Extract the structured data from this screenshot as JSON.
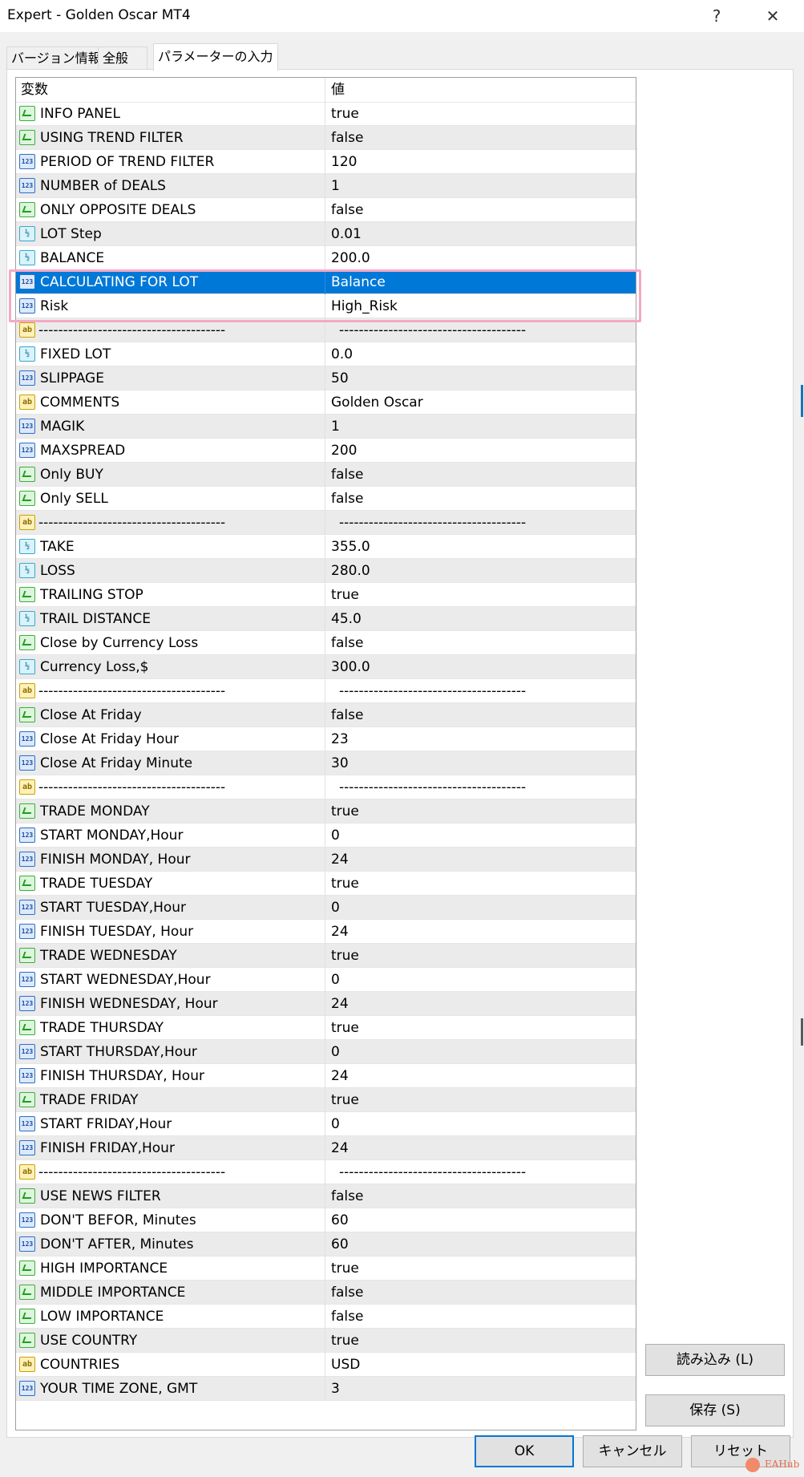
{
  "window": {
    "title": "Expert - Golden Oscar MT4",
    "help_glyph": "?",
    "close_glyph": "✕"
  },
  "tabs": [
    {
      "label": "バージョン情報",
      "active": false
    },
    {
      "label": "全般",
      "active": false
    },
    {
      "label": "パラメーターの入力",
      "active": true
    }
  ],
  "grid": {
    "col_variable": "変数",
    "col_value": "値",
    "rows": [
      {
        "name": "INFO PANEL",
        "value": "true",
        "type": "bool"
      },
      {
        "name": "USING TREND FILTER",
        "value": "false",
        "type": "bool"
      },
      {
        "name": "PERIOD OF TREND FILTER",
        "value": "120",
        "type": "int"
      },
      {
        "name": "NUMBER of DEALS",
        "value": "1",
        "type": "int"
      },
      {
        "name": "ONLY OPPOSITE DEALS",
        "value": "false",
        "type": "bool"
      },
      {
        "name": "LOT Step",
        "value": "0.01",
        "type": "double"
      },
      {
        "name": "BALANCE",
        "value": "200.0",
        "type": "double"
      },
      {
        "name": "CALCULATING FOR LOT",
        "value": "Balance",
        "type": "int",
        "selected": true
      },
      {
        "name": "Risk",
        "value": "High_Risk",
        "type": "int"
      },
      {
        "name": "--------------------------------------",
        "value": "--------------------------------------",
        "type": "string"
      },
      {
        "name": "FIXED LOT",
        "value": "0.0",
        "type": "double"
      },
      {
        "name": "SLIPPAGE",
        "value": "50",
        "type": "int"
      },
      {
        "name": "COMMENTS",
        "value": "Golden Oscar",
        "type": "string"
      },
      {
        "name": "MAGIK",
        "value": "1",
        "type": "int"
      },
      {
        "name": "MAXSPREAD",
        "value": "200",
        "type": "int"
      },
      {
        "name": "Only BUY",
        "value": "false",
        "type": "bool"
      },
      {
        "name": "Only SELL",
        "value": "false",
        "type": "bool"
      },
      {
        "name": "--------------------------------------",
        "value": "--------------------------------------",
        "type": "string"
      },
      {
        "name": "TAKE",
        "value": "355.0",
        "type": "double"
      },
      {
        "name": "LOSS",
        "value": "280.0",
        "type": "double"
      },
      {
        "name": "TRAILING STOP",
        "value": "true",
        "type": "bool"
      },
      {
        "name": "TRAIL DISTANCE",
        "value": "45.0",
        "type": "double"
      },
      {
        "name": "Close by Currency Loss",
        "value": "false",
        "type": "bool"
      },
      {
        "name": "Currency Loss,$",
        "value": "300.0",
        "type": "double"
      },
      {
        "name": "--------------------------------------",
        "value": "--------------------------------------",
        "type": "string"
      },
      {
        "name": "Close At Friday",
        "value": "false",
        "type": "bool"
      },
      {
        "name": "Close At Friday Hour",
        "value": "23",
        "type": "int"
      },
      {
        "name": "Close At Friday Minute",
        "value": "30",
        "type": "int"
      },
      {
        "name": "--------------------------------------",
        "value": "--------------------------------------",
        "type": "string"
      },
      {
        "name": "TRADE MONDAY",
        "value": "true",
        "type": "bool"
      },
      {
        "name": "START MONDAY,Hour",
        "value": "0",
        "type": "int"
      },
      {
        "name": "FINISH MONDAY, Hour",
        "value": "24",
        "type": "int"
      },
      {
        "name": "TRADE TUESDAY",
        "value": "true",
        "type": "bool"
      },
      {
        "name": "START TUESDAY,Hour",
        "value": "0",
        "type": "int"
      },
      {
        "name": "FINISH TUESDAY, Hour",
        "value": "24",
        "type": "int"
      },
      {
        "name": "TRADE WEDNESDAY",
        "value": "true",
        "type": "bool"
      },
      {
        "name": "START WEDNESDAY,Hour",
        "value": "0",
        "type": "int"
      },
      {
        "name": "FINISH WEDNESDAY, Hour",
        "value": "24",
        "type": "int"
      },
      {
        "name": "TRADE THURSDAY",
        "value": "true",
        "type": "bool"
      },
      {
        "name": "START THURSDAY,Hour",
        "value": "0",
        "type": "int"
      },
      {
        "name": "FINISH THURSDAY, Hour",
        "value": "24",
        "type": "int"
      },
      {
        "name": "TRADE FRIDAY",
        "value": "true",
        "type": "bool"
      },
      {
        "name": "START FRIDAY,Hour",
        "value": "0",
        "type": "int"
      },
      {
        "name": "FINISH FRIDAY,Hour",
        "value": "24",
        "type": "int"
      },
      {
        "name": "--------------------------------------",
        "value": "--------------------------------------",
        "type": "string"
      },
      {
        "name": "USE NEWS FILTER",
        "value": "false",
        "type": "bool"
      },
      {
        "name": "DON'T BEFOR, Minutes",
        "value": "60",
        "type": "int"
      },
      {
        "name": "DON'T AFTER, Minutes",
        "value": "60",
        "type": "int"
      },
      {
        "name": "HIGH IMPORTANCE",
        "value": "true",
        "type": "bool"
      },
      {
        "name": "MIDDLE IMPORTANCE",
        "value": "false",
        "type": "bool"
      },
      {
        "name": "LOW IMPORTANCE",
        "value": "false",
        "type": "bool"
      },
      {
        "name": "USE COUNTRY",
        "value": "true",
        "type": "bool"
      },
      {
        "name": "COUNTRIES",
        "value": "USD",
        "type": "string"
      },
      {
        "name": "YOUR TIME ZONE, GMT",
        "value": "3",
        "type": "int"
      }
    ]
  },
  "icons": {
    "bool": "bool-icon",
    "int": "int-icon",
    "double": "double-icon",
    "string": "string-icon",
    "glyph_int": "123",
    "glyph_double": "½",
    "glyph_string": "ab"
  },
  "buttons": {
    "load": "読み込み (L)",
    "save": "保存 (S)",
    "ok": "OK",
    "cancel": "キャンセル",
    "reset": "リセット"
  },
  "watermark": "EAHub",
  "colors": {
    "selection": "#0078d7",
    "highlight_box": "#f4a9c6",
    "alt_row": "#ebebeb"
  }
}
